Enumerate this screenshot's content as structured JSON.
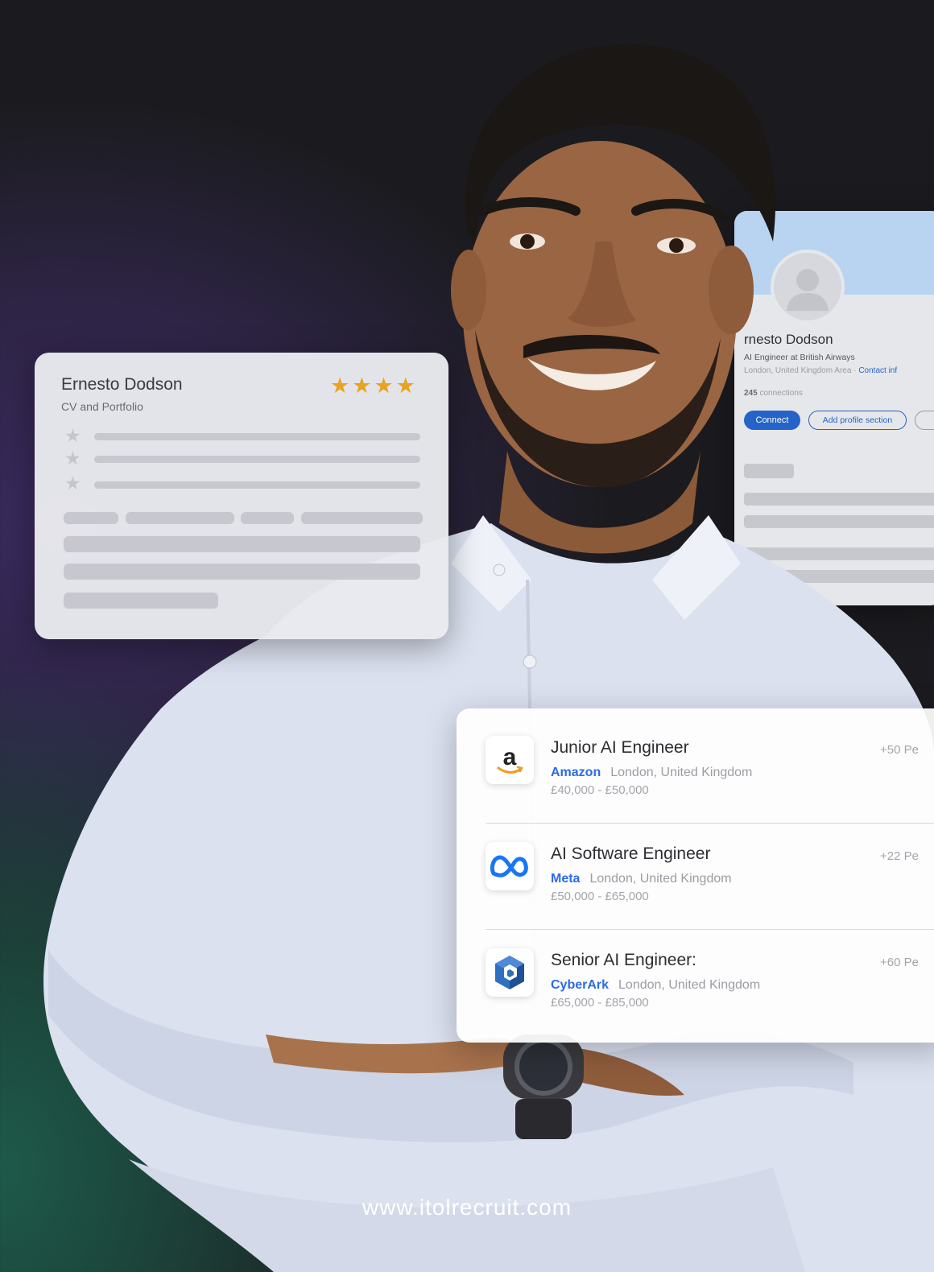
{
  "profile": {
    "name": "rnesto Dodson",
    "headline": "AI Engineer at British Airways",
    "location": "London, United Kingdom Area",
    "location_sep": " · ",
    "contact_link": "Contact inf",
    "connections_count": "245",
    "connections_label": " connections",
    "connect_label": "Connect",
    "add_section_label": "Add profile section"
  },
  "cv_card": {
    "name": "Ernesto Dodson",
    "subtitle": "CV and Portfolio",
    "rating_stars": "★★★★",
    "rating": 4,
    "star_glyph": "★"
  },
  "jobs": [
    {
      "title": "Junior AI Engineer",
      "company": "Amazon",
      "location": "London, United Kingdom",
      "salary": "£40,000 - £50,000",
      "applicants": "+50 Pe",
      "logo_icon": "amazon-logo"
    },
    {
      "title": "AI Software Engineer",
      "company": "Meta",
      "location": "London, United Kingdom",
      "salary": "£50,000 - £65,000",
      "applicants": "+22 Pe",
      "logo_icon": "meta-logo"
    },
    {
      "title": "Senior AI Engineer:",
      "company": "CyberArk",
      "location": "London, United Kingdom",
      "salary": "£65,000 - £85,000",
      "applicants": "+60 Pe",
      "logo_icon": "cyberark-logo"
    }
  ],
  "footer": {
    "url": "www.itolrecruit.com"
  },
  "colors": {
    "accent_blue": "#2463c7",
    "rating_gold": "#e8a321",
    "company_link": "#2b6be6"
  }
}
